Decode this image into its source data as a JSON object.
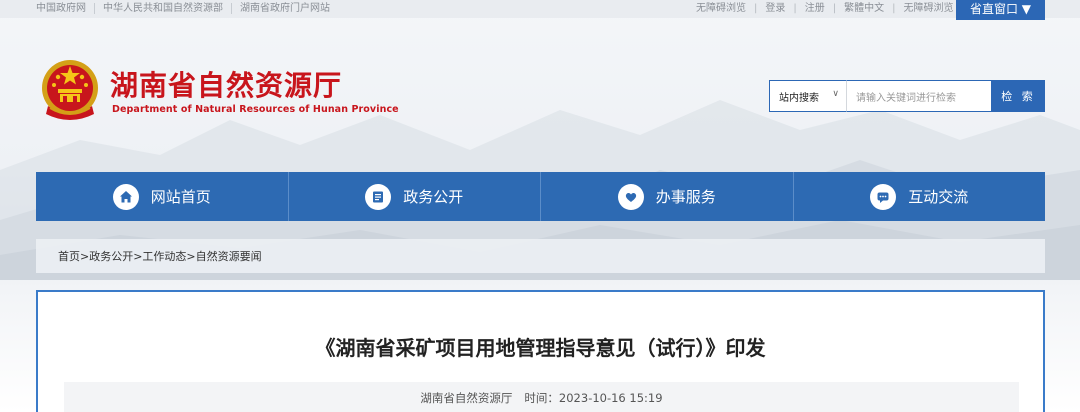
{
  "topbar": {
    "links": [
      "中国政府网",
      "中华人民共和国自然资源部",
      "湖南省政府门户网站"
    ],
    "right_links": [
      "无障碍浏览",
      "登录",
      "注册",
      "繁體中文",
      "无障碍浏览"
    ],
    "region_button": "省直窗口 ▼"
  },
  "header": {
    "title": "湖南省自然资源厅",
    "subtitle": "Department of Natural Resources of Hunan Province"
  },
  "search": {
    "scope": "站内搜索",
    "placeholder": "请输入关键词进行检索",
    "button": "检 索"
  },
  "nav": {
    "items": [
      {
        "label": "网站首页",
        "icon": "home-icon"
      },
      {
        "label": "政务公开",
        "icon": "document-icon"
      },
      {
        "label": "办事服务",
        "icon": "heart-hands-icon"
      },
      {
        "label": "互动交流",
        "icon": "chat-icon"
      }
    ]
  },
  "breadcrumb": {
    "text": "首页>政务公开>工作动态>自然资源要闻"
  },
  "article": {
    "title": "《湖南省采矿项目用地管理指导意见（试行）》印发",
    "source": "湖南省自然资源厅",
    "time": "时间：2023-10-16 15:19"
  },
  "colors": {
    "brand_red": "#c8151c",
    "nav_blue": "#2d6ab3",
    "accent_blue": "#2c67b5"
  }
}
